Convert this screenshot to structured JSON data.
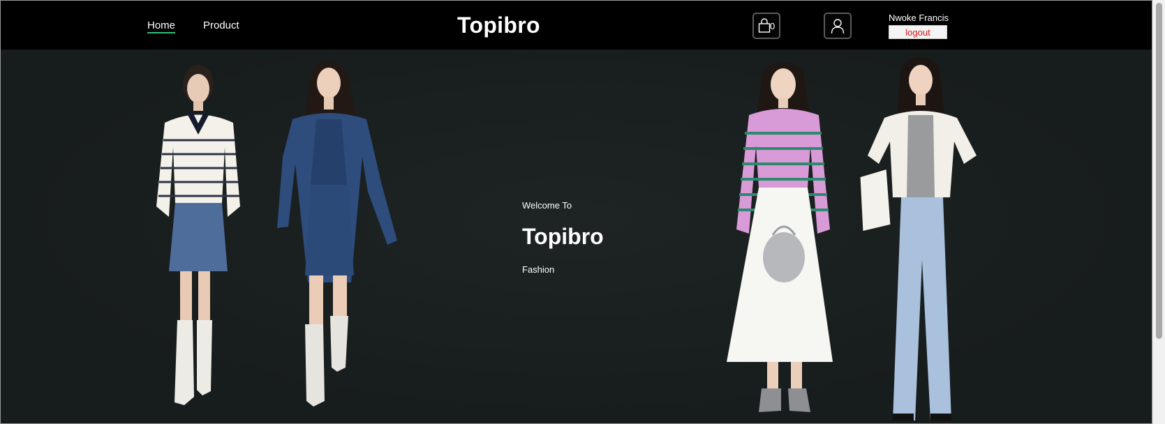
{
  "nav": {
    "home": "Home",
    "product": "Product"
  },
  "brand": "Topibro",
  "cart": {
    "count": "0",
    "icon": "shopping-bag-icon"
  },
  "user": {
    "icon": "user-icon",
    "name": "Nwoke Francis",
    "logout": "logout"
  },
  "hero": {
    "welcome": "Welcome To",
    "title": "Topibro",
    "subtitle": "Fashion"
  },
  "colors": {
    "header_bg": "#000000",
    "hero_bg": "#181d1d",
    "active_underline": "#2fc27a",
    "logout_text": "#e01010"
  }
}
